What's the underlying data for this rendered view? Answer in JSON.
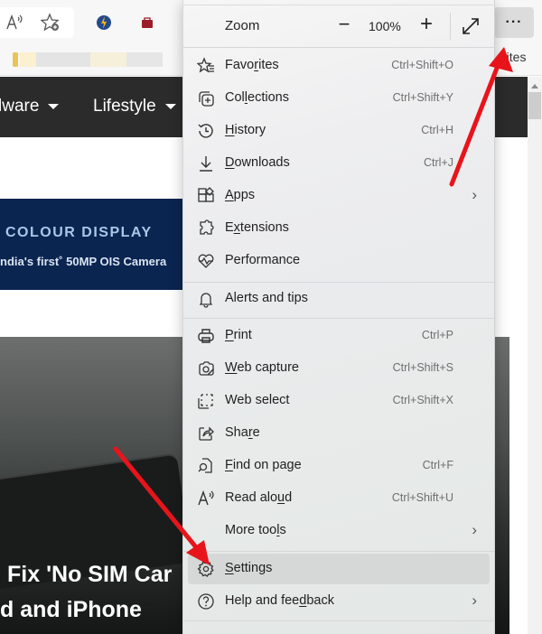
{
  "browser": {
    "toolbar_icons": [
      {
        "name": "read-aloud-icon",
        "glyph": "A⁾"
      },
      {
        "name": "add-favorite-icon",
        "glyph": "☆"
      },
      {
        "name": "extension-bolt-icon",
        "glyph": "⚡"
      },
      {
        "name": "extension-bag-icon",
        "glyph": "■"
      }
    ],
    "more_button_label": "···",
    "favorites_bar_text": "rites"
  },
  "page": {
    "nav_items": [
      "lware",
      "Lifestyle"
    ],
    "banner": {
      "title": "COLOUR DISPLAY",
      "subtitle": "ndia's first˚ 50MP OIS Camera"
    },
    "hero_title_lines": [
      "Fix 'No SIM Car",
      "d and iPhone"
    ]
  },
  "menu": {
    "zoom": {
      "label": "Zoom",
      "minus": "−",
      "value": "100%",
      "plus": "+"
    },
    "items": [
      {
        "id": "favorites",
        "label": "Favorites",
        "mnemonic_index": 4,
        "shortcut": "Ctrl+Shift+O",
        "icon": "favorites-icon"
      },
      {
        "id": "collections",
        "label": "Collections",
        "mnemonic_index": 3,
        "shortcut": "Ctrl+Shift+Y",
        "icon": "collections-icon"
      },
      {
        "id": "history",
        "label": "History",
        "mnemonic_index": 0,
        "shortcut": "Ctrl+H",
        "icon": "history-icon"
      },
      {
        "id": "downloads",
        "label": "Downloads",
        "mnemonic_index": 0,
        "shortcut": "Ctrl+J",
        "icon": "downloads-icon"
      },
      {
        "id": "apps",
        "label": "Apps",
        "mnemonic_index": 0,
        "submenu": true,
        "icon": "apps-icon"
      },
      {
        "id": "extensions",
        "label": "Extensions",
        "mnemonic_index": 1,
        "icon": "extensions-icon"
      },
      {
        "id": "performance",
        "label": "Performance",
        "icon": "performance-icon"
      },
      {
        "id": "alerts",
        "label": "Alerts and tips",
        "icon": "bell-icon"
      },
      {
        "id": "print",
        "label": "Print",
        "mnemonic_index": 0,
        "shortcut": "Ctrl+P",
        "icon": "print-icon"
      },
      {
        "id": "web-capture",
        "label": "Web capture",
        "mnemonic_index": 0,
        "shortcut": "Ctrl+Shift+S",
        "icon": "web-capture-icon"
      },
      {
        "id": "web-select",
        "label": "Web select",
        "shortcut": "Ctrl+Shift+X",
        "icon": "web-select-icon"
      },
      {
        "id": "share",
        "label": "Share",
        "mnemonic_index": 3,
        "icon": "share-icon"
      },
      {
        "id": "find",
        "label": "Find on page",
        "mnemonic_index": 0,
        "shortcut": "Ctrl+F",
        "icon": "find-on-page-icon"
      },
      {
        "id": "read-aloud",
        "label": "Read aloud",
        "mnemonic_index": 8,
        "shortcut": "Ctrl+Shift+U",
        "icon": "read-aloud-icon"
      },
      {
        "id": "more-tools",
        "label": "More tools",
        "mnemonic_index": 8,
        "submenu": true,
        "icon": ""
      },
      {
        "id": "settings",
        "label": "Settings",
        "mnemonic_index": 0,
        "highlighted": true,
        "icon": "settings-icon"
      },
      {
        "id": "help",
        "label": "Help and feedback",
        "mnemonic_index": 12,
        "submenu": true,
        "icon": "help-icon"
      }
    ]
  },
  "annotations": {
    "arrow_color": "#e8141b"
  }
}
